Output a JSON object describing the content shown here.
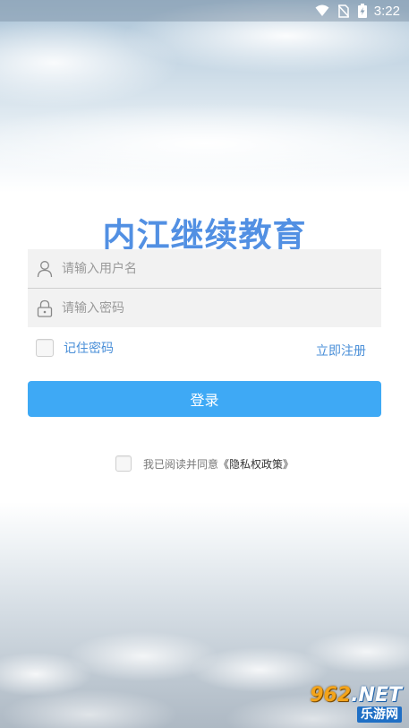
{
  "status_bar": {
    "time": "3:22",
    "icons": [
      "wifi-icon",
      "no-sim-icon",
      "battery-charging-icon"
    ]
  },
  "app": {
    "title": "内江继续教育"
  },
  "login_form": {
    "username": {
      "value": "",
      "placeholder": "请输入用户名",
      "icon": "user-icon"
    },
    "password": {
      "value": "",
      "placeholder": "请输入密码",
      "icon": "lock-icon"
    },
    "remember_label": "记住密码",
    "remember_checked": false,
    "register_label": "立即注册",
    "login_label": "登录"
  },
  "agreement": {
    "checked": false,
    "text": "我已阅读并同意",
    "policy_label": "《隐私权政策》"
  },
  "watermark": {
    "number": "962",
    "suffix": ".NET",
    "subtitle": "乐游网"
  },
  "colors": {
    "title": "#5290e3",
    "link": "#4a8fd8",
    "button": "#3ea9f5",
    "field_bg": "#f2f2f2"
  }
}
